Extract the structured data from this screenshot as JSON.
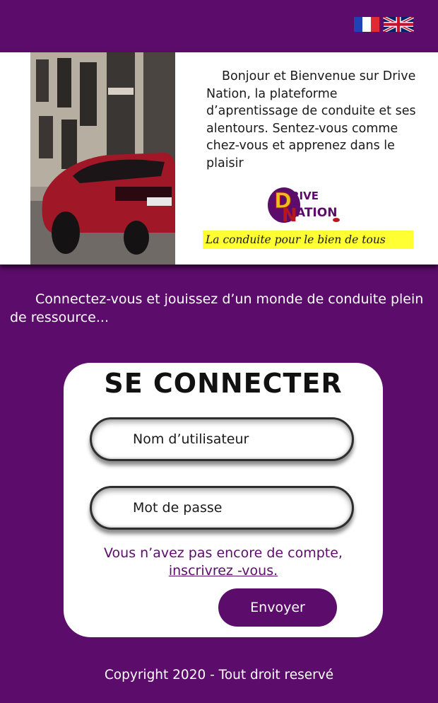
{
  "languages": [
    {
      "name": "French",
      "icon": "france-flag-icon"
    },
    {
      "name": "English",
      "icon": "uk-flag-icon"
    }
  ],
  "hero": {
    "welcome_text": "Bonjour et Bienvenue sur Drive Nation, la plateforme d’aprentissage de conduite et ses alentours. Sentez-vous comme chez-vous et apprenez dans le plaisir",
    "logo": {
      "line1": "RIVE",
      "line2": "ATION",
      "letter1": "D",
      "letter2": "N"
    },
    "tagline": "La conduite pour le bien de tous"
  },
  "intro": "Connectez-vous et jouissez d’un monde de conduite plein de ressource...",
  "login": {
    "title": "SE CONNECTER",
    "username_placeholder": "Nom d’utilisateur",
    "password_placeholder": "Mot de passe",
    "signup_prompt": "Vous n’avez pas encore de compte,",
    "signup_link": "inscrivrez -vous.",
    "submit_label": "Envoyer"
  },
  "footer": "Copyright 2020 - Tout droit reservé",
  "colors": {
    "brand_purple": "#5c0c6a",
    "tagline_highlight": "#ffff33",
    "card_background": "#ffffff"
  }
}
